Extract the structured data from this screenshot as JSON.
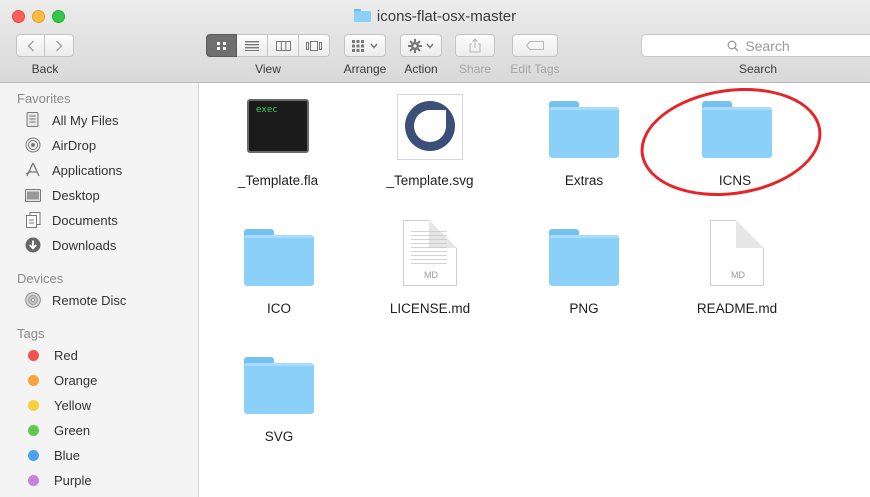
{
  "window": {
    "title": "icons-flat-osx-master"
  },
  "toolbar": {
    "back_label": "Back",
    "view_label": "View",
    "arrange_label": "Arrange",
    "action_label": "Action",
    "share_label": "Share",
    "edit_tags_label": "Edit Tags",
    "search_label": "Search",
    "search_placeholder": "Search",
    "active_view": "icon"
  },
  "sidebar": {
    "favorites_title": "Favorites",
    "favorites": [
      {
        "label": "All My Files",
        "icon": "all-files-icon"
      },
      {
        "label": "AirDrop",
        "icon": "airdrop-icon"
      },
      {
        "label": "Applications",
        "icon": "applications-icon"
      },
      {
        "label": "Desktop",
        "icon": "desktop-icon"
      },
      {
        "label": "Documents",
        "icon": "documents-icon"
      },
      {
        "label": "Downloads",
        "icon": "downloads-icon"
      }
    ],
    "devices_title": "Devices",
    "devices": [
      {
        "label": "Remote Disc",
        "icon": "remote-disc-icon"
      }
    ],
    "tags_title": "Tags",
    "tags": [
      {
        "label": "Red",
        "color": "#f0524f"
      },
      {
        "label": "Orange",
        "color": "#f7a33a"
      },
      {
        "label": "Yellow",
        "color": "#f7cf3b"
      },
      {
        "label": "Green",
        "color": "#5ec94c"
      },
      {
        "label": "Blue",
        "color": "#4aa2f4"
      },
      {
        "label": "Purple",
        "color": "#c97fe0"
      }
    ]
  },
  "files": [
    {
      "name": "_Template.fla",
      "type": "exec",
      "icon_text": "exec"
    },
    {
      "name": "_Template.svg",
      "type": "svg"
    },
    {
      "name": "Extras",
      "type": "folder"
    },
    {
      "name": "ICNS",
      "type": "folder",
      "highlighted": true
    },
    {
      "name": "ICO",
      "type": "folder"
    },
    {
      "name": "LICENSE.md",
      "type": "document",
      "doc_tag": "MD"
    },
    {
      "name": "PNG",
      "type": "folder"
    },
    {
      "name": "README.md",
      "type": "document",
      "doc_tag": "MD"
    },
    {
      "name": "SVG",
      "type": "folder"
    }
  ],
  "colors": {
    "folder": "#8ad0f8",
    "annotation": "#e4262a"
  }
}
